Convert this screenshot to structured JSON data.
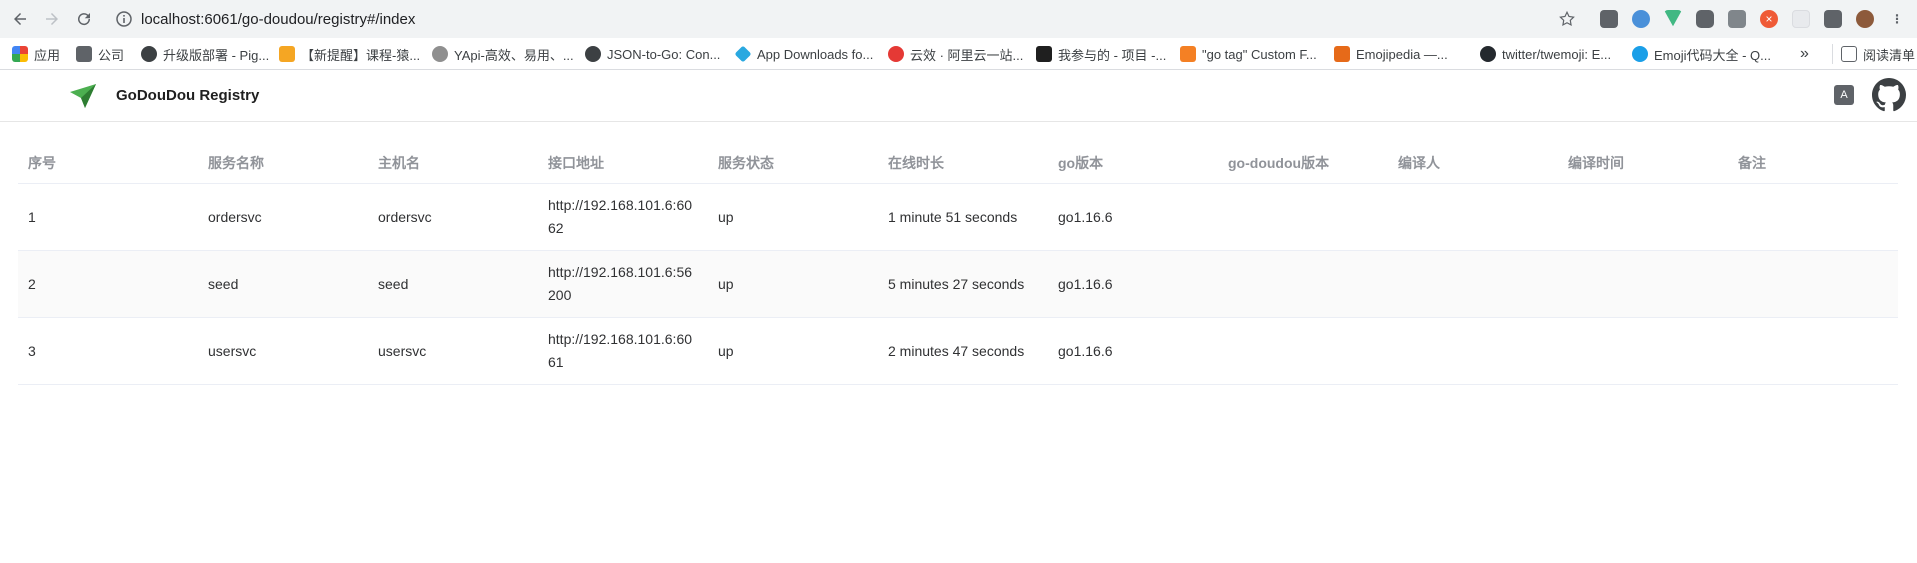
{
  "browser": {
    "url": "localhost:6061/go-doudou/registry#/index",
    "bookmarks": [
      {
        "label": "应用",
        "color": "#e94235"
      },
      {
        "label": "公司",
        "color": "#5f6368"
      },
      {
        "label": "升级版部署 - Pig...",
        "color": "#3c4043"
      },
      {
        "label": "【新提醒】课程-猿...",
        "color": "#f5a623"
      },
      {
        "label": "YApi-高效、易用、...",
        "color": "#8f8f8f"
      },
      {
        "label": "JSON-to-Go: Con...",
        "color": "#3c4043"
      },
      {
        "label": "App Downloads fo...",
        "color": "#29a8e0"
      },
      {
        "label": "云效 · 阿里云一站...",
        "color": "#e53935"
      },
      {
        "label": "我参与的 - 项目 -...",
        "color": "#1f1f1f"
      },
      {
        "label": "\"go tag\" Custom F...",
        "color": "#f48024"
      },
      {
        "label": "Emojipedia —...",
        "color": "#e66a19"
      },
      {
        "label": "twitter/twemoji: E...",
        "color": "#24292e"
      },
      {
        "label": "Emoji代码大全 - Q...",
        "color": "#1a9fe8"
      }
    ],
    "more_label": "»",
    "reading_list": "阅读清单"
  },
  "app": {
    "brand": "GoDouDou Registry",
    "brand_color": "#4caf50"
  },
  "table": {
    "headers": [
      "序号",
      "服务名称",
      "主机名",
      "接口地址",
      "服务状态",
      "在线时长",
      "go版本",
      "go-doudou版本",
      "编译人",
      "编译时间",
      "备注"
    ],
    "rows": [
      [
        "1",
        "ordersvc",
        "ordersvc",
        "http://192.168.101.6:6062",
        "up",
        "1 minute 51 seconds",
        "go1.16.6",
        "",
        "",
        "",
        ""
      ],
      [
        "2",
        "seed",
        "seed",
        "http://192.168.101.6:56200",
        "up",
        "5 minutes 27 seconds",
        "go1.16.6",
        "",
        "",
        "",
        ""
      ],
      [
        "3",
        "usersvc",
        "usersvc",
        "http://192.168.101.6:6061",
        "up",
        "2 minutes 47 seconds",
        "go1.16.6",
        "",
        "",
        "",
        ""
      ]
    ]
  }
}
